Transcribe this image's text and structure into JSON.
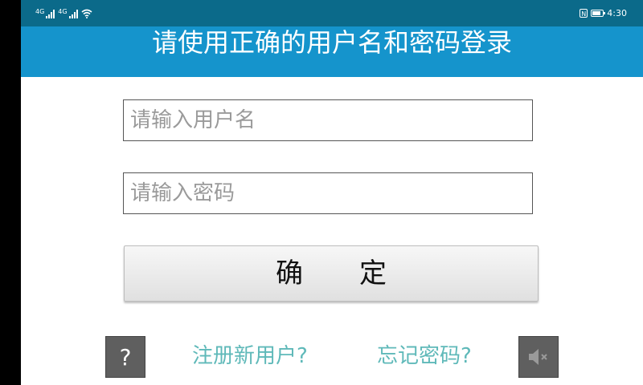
{
  "status_bar": {
    "left_icons": [
      "signal-1-icon",
      "signal-2-icon",
      "wifi-icon"
    ],
    "signal_label": "4G",
    "nfc_label": "N",
    "time": "4:30"
  },
  "header": {
    "title": "请使用正确的用户名和密码登录",
    "background": "#1594cc"
  },
  "form": {
    "username": {
      "value": "",
      "placeholder": "请输入用户名"
    },
    "password": {
      "value": "",
      "placeholder": "请输入密码"
    },
    "submit_label": "确定"
  },
  "footer": {
    "help_label": "?",
    "register_link": "注册新用户?",
    "forgot_link": "忘记密码?",
    "mute_icon": "speaker-mute-icon",
    "link_color": "#5fb9b9"
  }
}
